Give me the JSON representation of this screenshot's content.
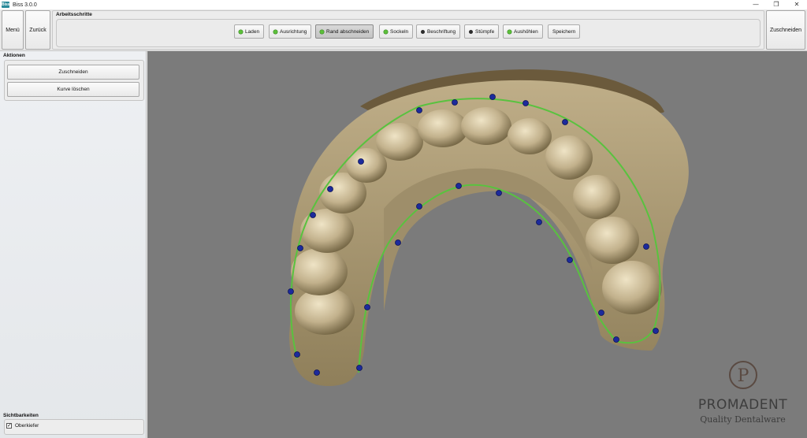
{
  "window": {
    "icon_text": "Biss",
    "title": "Biss 3.0.0",
    "minimize_glyph": "—",
    "restore_glyph": "❐",
    "close_glyph": "✕"
  },
  "toolbar": {
    "menu_label": "Menü",
    "back_label": "Zurück",
    "steps_title": "Arbeitsschritte",
    "trim_label": "Zuschneiden",
    "steps": [
      {
        "label": "Laden",
        "status": "done"
      },
      {
        "label": "Ausrichtung",
        "status": "done"
      },
      {
        "label": "Rand abschneiden",
        "status": "active"
      },
      {
        "label": "Sockeln",
        "status": "done"
      },
      {
        "label": "Beschriftung",
        "status": "pending"
      },
      {
        "label": "Stümpfe",
        "status": "pending"
      },
      {
        "label": "Aushöhlen",
        "status": "done"
      },
      {
        "label": "Speichern",
        "status": "none"
      }
    ]
  },
  "actions": {
    "title": "Aktionen",
    "trim_button": "Zuschneiden",
    "delete_curve_button": "Kurve löschen"
  },
  "visibility": {
    "title": "Sichtbarkeiten",
    "upper_jaw_label": "Oberkiefer",
    "upper_jaw_checked": true
  },
  "logo": {
    "monogram": "P",
    "name": "PROMADENT",
    "tagline": "Quality Dentalware"
  },
  "colors": {
    "viewport_bg": "#7b7b7b",
    "model": "#b5a482",
    "trim_curve": "#59c23f",
    "control_point": "#1c2a9c",
    "done_dot": "#5cbf3a"
  },
  "icons": [
    "checkmark-icon",
    "status-dot-icon",
    "dental-model",
    "promadent-logo"
  ]
}
